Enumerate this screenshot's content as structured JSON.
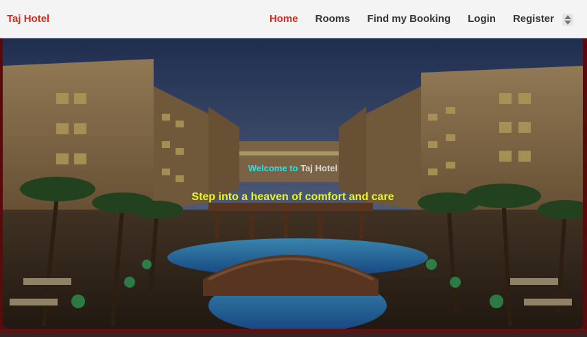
{
  "brand": {
    "name": "Taj Hotel"
  },
  "nav": {
    "home": "Home",
    "rooms": "Rooms",
    "find_booking": "Find my Booking",
    "login": "Login",
    "register": "Register"
  },
  "hero": {
    "welcome_prefix": "Welcome to",
    "welcome_name": "Taj Hotel",
    "tagline": "Step into a heaven of comfort and care"
  },
  "colors": {
    "brand_red": "#d42a1e",
    "welcome_cyan": "#1ee6e6",
    "tagline_yellow": "#e7f52a"
  },
  "icons": {
    "scroll": "up-down-arrows-icon"
  }
}
